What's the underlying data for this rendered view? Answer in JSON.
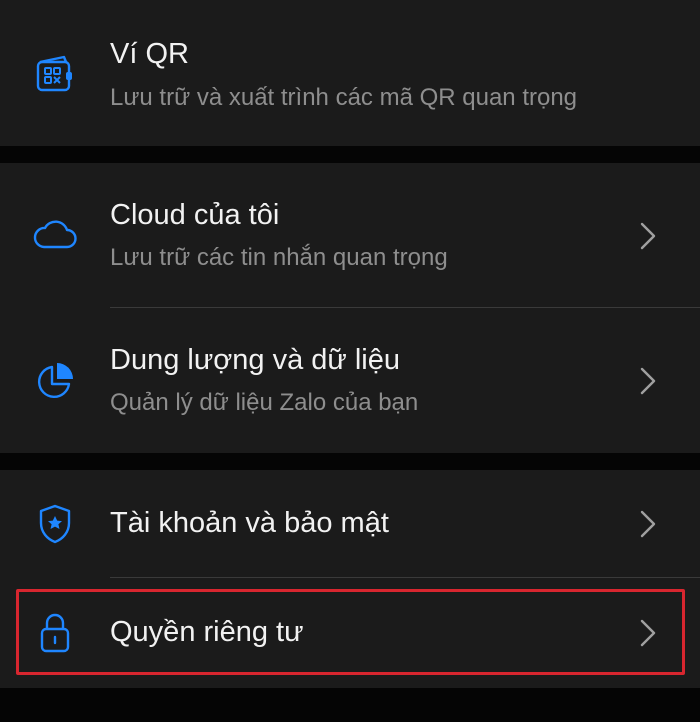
{
  "colors": {
    "background": "#050505",
    "section": "#1b1b1b",
    "accent_blue": "#1f86ff",
    "title_text": "#f2f2f2",
    "subtitle_text": "#8e8e8e",
    "highlight": "#d8262f"
  },
  "items": [
    {
      "icon": "qr-wallet-icon",
      "title": "Ví QR",
      "subtitle": "Lưu trữ và xuất trình các mã QR quan trọng"
    },
    {
      "icon": "cloud-icon",
      "title": "Cloud của tôi",
      "subtitle": "Lưu trữ các tin nhắn quan trọng",
      "chevron": "chevron-right-icon"
    },
    {
      "icon": "pie-chart-icon",
      "title": "Dung lượng và dữ liệu",
      "subtitle": "Quản lý dữ liệu Zalo của bạn",
      "chevron": "chevron-right-icon"
    },
    {
      "icon": "shield-star-icon",
      "title": "Tài khoản và bảo mật",
      "chevron": "chevron-right-icon"
    },
    {
      "icon": "lock-icon",
      "title": "Quyền riêng tư",
      "chevron": "chevron-right-icon",
      "highlighted": true
    }
  ]
}
